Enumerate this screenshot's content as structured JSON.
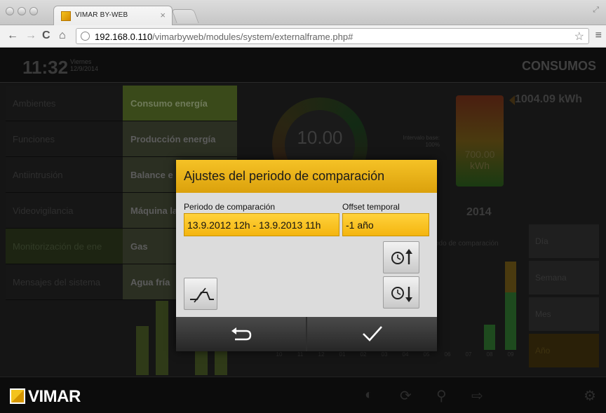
{
  "browser": {
    "tab_title": "VIMAR BY-WEB",
    "tab_close": "×",
    "url_host": "192.168.0.110",
    "url_path": "/vimarbyweb/modules/system/externalframe.php#"
  },
  "header": {
    "time": "11:32",
    "weekday": "Viernes",
    "date": "12/9/2014",
    "title": "CONSUMOS"
  },
  "left_nav": {
    "items": [
      {
        "label": "Ambientes"
      },
      {
        "label": "Funciones"
      },
      {
        "label": "Antiintrusión"
      },
      {
        "label": "Videovigilancia"
      },
      {
        "label": "Monitorización de ene"
      },
      {
        "label": "Mensajes del sistema"
      }
    ]
  },
  "sub_nav": {
    "items": [
      {
        "label": "Consumo energía"
      },
      {
        "label": "Producción energía"
      },
      {
        "label": "Balance e"
      },
      {
        "label": "Máquina la"
      },
      {
        "label": "Gas"
      },
      {
        "label": "Agua fría"
      }
    ]
  },
  "dashboard": {
    "gauge_value": "10.00",
    "interval_label": "Intervalo base:",
    "interval_value": "100%",
    "meter_value": "700.00",
    "meter_unit": "kWh",
    "total": "1004.09 kWh",
    "year": "2014",
    "comparison_label": "odo de comparación",
    "x_labels": [
      "10",
      "11",
      "12",
      "01",
      "02",
      "03",
      "04",
      "05",
      "06",
      "07",
      "08",
      "09"
    ]
  },
  "right_nav": {
    "items": [
      {
        "label": "Día"
      },
      {
        "label": "Semana"
      },
      {
        "label": "Mes"
      },
      {
        "label": "Año"
      }
    ]
  },
  "footer": {
    "logo_text": "VIMAR"
  },
  "dialog": {
    "title": "Ajustes del periodo de comparación",
    "period_label": "Periodo de comparación",
    "period_value": "13.9.2012 12h - 13.9.2013 11h",
    "offset_label": "Offset temporal",
    "offset_value": "-1 año"
  },
  "colors": {
    "accent": "#f4b50f",
    "dialog_bg": "#dcdcdc"
  }
}
